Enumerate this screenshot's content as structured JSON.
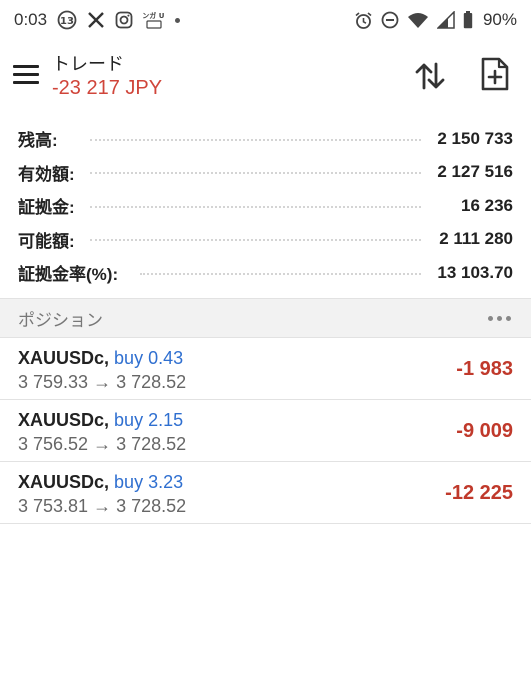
{
  "status_bar": {
    "time": "0:03",
    "battery": "90%",
    "manga_icon_text": "マンガ UP!",
    "icons": [
      "13-badge-icon",
      "x-icon",
      "instagram-icon",
      "manga-up-icon",
      "notification-dot-icon",
      "alarm-icon",
      "dnd-icon",
      "wifi-icon",
      "signal-icon",
      "battery-icon"
    ]
  },
  "app_bar": {
    "title": "トレード",
    "subtitle": "-23 217 JPY",
    "subtitle_color": "#d0453a",
    "icons": [
      "menu-icon",
      "sort-icon",
      "new-order-icon"
    ]
  },
  "summary": [
    {
      "label": "残高:",
      "value": "2 150 733"
    },
    {
      "label": "有効額:",
      "value": "2 127 516"
    },
    {
      "label": "証拠金:",
      "value": "16 236"
    },
    {
      "label": "可能額:",
      "value": "2 111 280"
    },
    {
      "label": "証拠金率(%):",
      "value": "13 103.70"
    }
  ],
  "positions": {
    "title": "ポジション",
    "items": [
      {
        "symbol": "XAUUSDc,",
        "side": "buy 0.43",
        "prices": "3 759.33 → 3 728.52",
        "profit": "-1 983"
      },
      {
        "symbol": "XAUUSDc,",
        "side": "buy 2.15",
        "prices": "3 756.52 → 3 728.52",
        "profit": "-9 009"
      },
      {
        "symbol": "XAUUSDc,",
        "side": "buy 3.23",
        "prices": "3 753.81 → 3 728.52",
        "profit": "-12 225"
      }
    ]
  },
  "colors": {
    "loss": "#c0392b",
    "buy": "#2f6fd0",
    "section_bg": "#f2f2f2"
  }
}
